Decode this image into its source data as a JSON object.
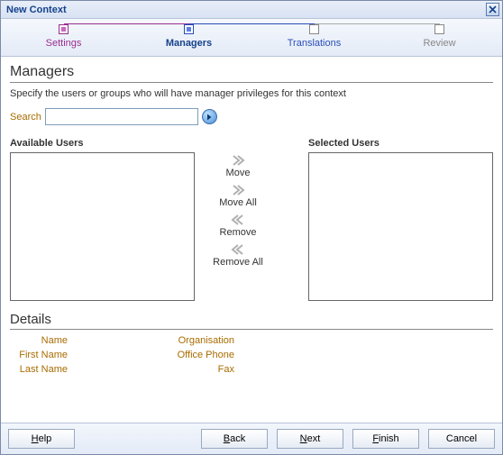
{
  "window": {
    "title": "New Context"
  },
  "steps": [
    {
      "label": "Settings",
      "state": "visited"
    },
    {
      "label": "Managers",
      "state": "current"
    },
    {
      "label": "Translations",
      "state": "future"
    },
    {
      "label": "Review",
      "state": "disabled"
    }
  ],
  "page": {
    "title": "Managers",
    "description": "Specify the users or groups who will have manager privileges for this context"
  },
  "search": {
    "label": "Search",
    "value": ""
  },
  "lists": {
    "available": {
      "label": "Available Users",
      "items": []
    },
    "selected": {
      "label": "Selected Users",
      "items": []
    }
  },
  "actions": {
    "move": "Move",
    "move_all": "Move All",
    "remove": "Remove",
    "remove_all": "Remove All"
  },
  "details": {
    "title": "Details",
    "fields": {
      "name": "Name",
      "organisation": "Organisation",
      "first_name": "First Name",
      "office_phone": "Office Phone",
      "last_name": "Last Name",
      "fax": "Fax"
    }
  },
  "buttons": {
    "help": "Help",
    "back": "Back",
    "next": "Next",
    "finish": "Finish",
    "cancel": "Cancel"
  }
}
